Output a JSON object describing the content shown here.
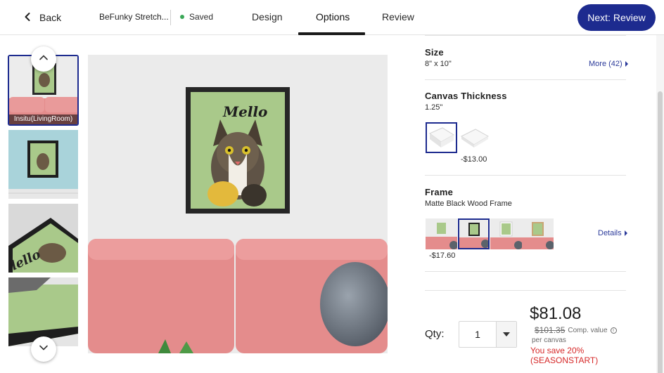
{
  "header": {
    "back_label": "Back",
    "project_name": "BeFunky Stretch...",
    "saved_label": "Saved",
    "tabs": [
      {
        "label": "Design",
        "active": false
      },
      {
        "label": "Options",
        "active": true
      },
      {
        "label": "Review",
        "active": false
      }
    ],
    "next_label": "Next: Review",
    "accent_color": "#1d2b8f"
  },
  "thumbnails": {
    "items": [
      {
        "caption": "Insitu(LivingRoom)",
        "selected": true
      },
      {
        "caption": "",
        "selected": false
      },
      {
        "caption": "",
        "selected": false
      },
      {
        "caption": "",
        "selected": false
      }
    ]
  },
  "preview": {
    "frame_text": "Mello"
  },
  "options": {
    "size": {
      "title": "Size",
      "value": "8\" x 10\"",
      "more_label": "More (42)"
    },
    "thickness": {
      "title": "Canvas Thickness",
      "value": "1.25\"",
      "choices": [
        {
          "price_label": "",
          "selected": true
        },
        {
          "price_label": "-$13.00",
          "selected": false
        }
      ]
    },
    "frame": {
      "title": "Frame",
      "value": "Matte Black Wood Frame",
      "details_label": "Details",
      "choices": [
        {
          "name": "no-frame",
          "selected": false
        },
        {
          "name": "black-frame",
          "selected": true
        },
        {
          "name": "white-frame",
          "selected": false
        },
        {
          "name": "wood-frame",
          "selected": false
        }
      ],
      "price_label": "-$17.60"
    }
  },
  "purchase": {
    "qty_label": "Qty:",
    "qty_value": "1",
    "price": "$81.08",
    "comp_price": "$101.35",
    "comp_label": "Comp. value",
    "per_unit": "per canvas",
    "save_line1": "You save 20%",
    "save_line2": "(SEASONSTART)",
    "sale_color": "#d62828"
  }
}
